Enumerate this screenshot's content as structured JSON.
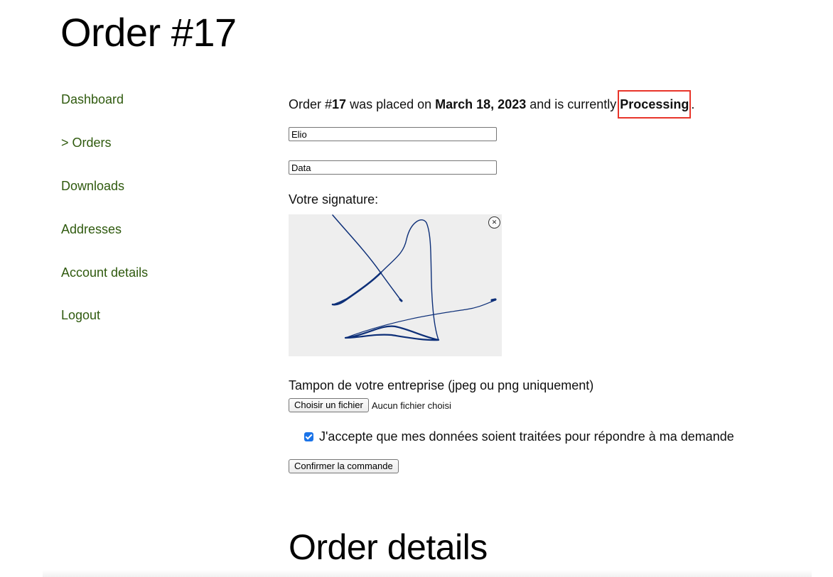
{
  "page_title": "Order #17",
  "sidebar": {
    "items": [
      {
        "label": "Dashboard"
      },
      {
        "label": "> Orders"
      },
      {
        "label": "Downloads"
      },
      {
        "label": "Addresses"
      },
      {
        "label": "Account details"
      },
      {
        "label": "Logout"
      }
    ]
  },
  "order_status": {
    "prefix": "Order #",
    "number": "17",
    "placed_text": " was placed on ",
    "date": "March 18, 2023",
    "currently_text": " and is currently",
    "status": "Processing",
    "suffix": "."
  },
  "form": {
    "first_field_value": "Elio",
    "second_field_value": "Data",
    "signature_label": "Votre signature:",
    "signature_clear_icon": "close-icon",
    "stamp_label": "Tampon de votre entreprise (jpeg ou png uniquement)",
    "file_button_label": "Choisir un fichier",
    "file_status": "Aucun fichier choisi",
    "consent_label": "J'accepte que mes données soient traitées pour répondre à ma demande",
    "consent_checked": true,
    "submit_label": "Confirmer la commande"
  },
  "order_details_title": "Order details",
  "colors": {
    "nav_link": "#2f5a0e",
    "highlight_border": "#e8352a",
    "checkbox": "#1a73e8",
    "signature_ink": "#0d2f78",
    "signature_pad": "#eeeeee"
  }
}
